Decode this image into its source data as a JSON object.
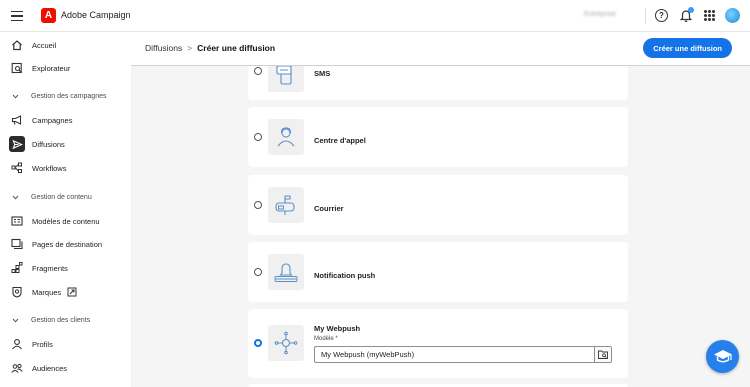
{
  "app": {
    "name": "Adobe Campaign",
    "org": "Entreprise"
  },
  "sidebar": {
    "items": [
      {
        "label": "Accueil",
        "icon": "home-icon"
      },
      {
        "label": "Explorateur",
        "icon": "explorer-icon"
      },
      {
        "label": "Campagnes",
        "icon": "megaphone-icon"
      },
      {
        "label": "Diffusions",
        "icon": "send-icon"
      },
      {
        "label": "Workflows",
        "icon": "workflow-icon"
      },
      {
        "label": "Modèles de contenu",
        "icon": "template-icon"
      },
      {
        "label": "Pages de destination",
        "icon": "pages-icon"
      },
      {
        "label": "Fragments",
        "icon": "fragments-icon"
      },
      {
        "label": "Marques",
        "icon": "brand-icon"
      },
      {
        "label": "Profils",
        "icon": "user-icon"
      },
      {
        "label": "Audiences",
        "icon": "audiences-icon"
      }
    ],
    "sections": [
      {
        "label": "Gestion des campagnes"
      },
      {
        "label": "Gestion de contenu"
      },
      {
        "label": "Gestion des clients"
      }
    ],
    "active": "Diffusions"
  },
  "header": {
    "breadcrumb_parent": "Diffusions",
    "breadcrumb_separator": ">",
    "breadcrumb_current": "Créer une diffusion",
    "create_button": "Créer une diffusion"
  },
  "channels": [
    {
      "title": "SMS",
      "selected": false,
      "icon": "sms-icon"
    },
    {
      "title": "Centre d'appel",
      "selected": false,
      "icon": "call-center-icon"
    },
    {
      "title": "Courrier",
      "selected": false,
      "icon": "mailbox-icon"
    },
    {
      "title": "Notification push",
      "selected": false,
      "icon": "push-notification-icon"
    },
    {
      "title": "My Webpush",
      "selected": true,
      "icon": "webpush-icon",
      "field_label": "Modèle",
      "required_mark": "*",
      "field_value": "My Webpush (myWebPush)"
    }
  ],
  "colors": {
    "accent": "#1473e6",
    "logo": "#eb1000",
    "notification_dot": "#3b9aff",
    "fab": "#2680eb"
  }
}
